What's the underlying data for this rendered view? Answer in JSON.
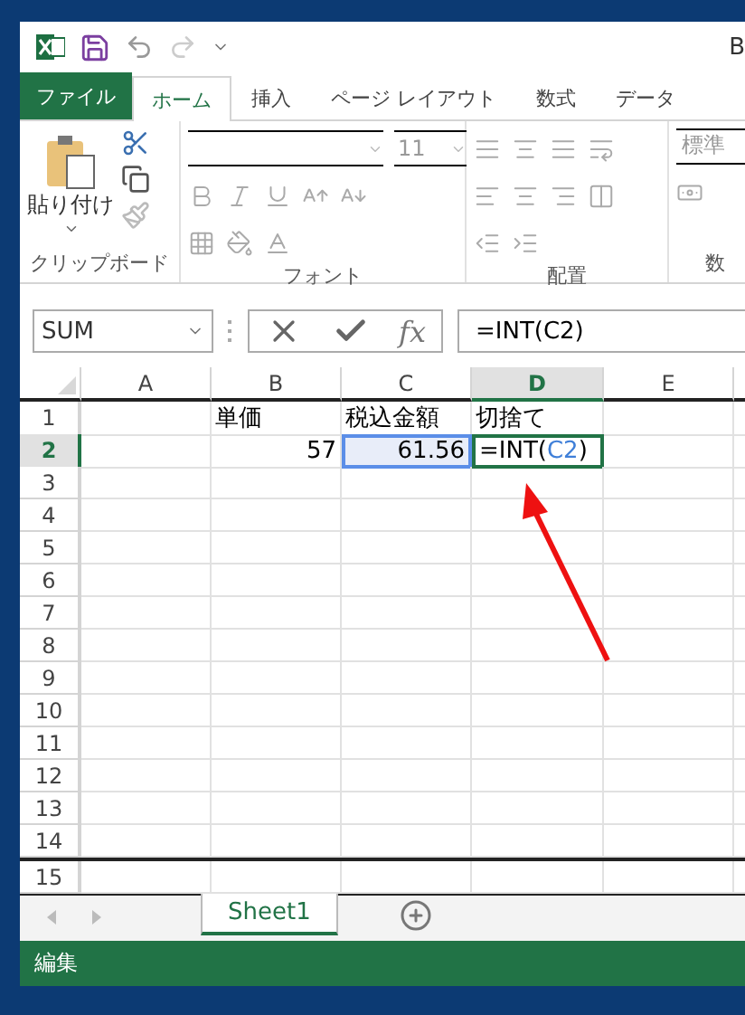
{
  "window": {
    "title": "B"
  },
  "ribbon_tabs": [
    {
      "label": "ファイル",
      "kind": "file",
      "selected": false
    },
    {
      "label": "ホーム",
      "kind": "tab",
      "selected": true
    },
    {
      "label": "挿入",
      "kind": "tab",
      "selected": false
    },
    {
      "label": "ページ レイアウト",
      "kind": "tab",
      "selected": false
    },
    {
      "label": "数式",
      "kind": "tab",
      "selected": false
    },
    {
      "label": "データ",
      "kind": "tab",
      "selected": false
    }
  ],
  "ribbon": {
    "paste_label": "貼り付け",
    "font_size": "11",
    "number_format": "標準",
    "groups": [
      "クリップボード",
      "フォント",
      "配置",
      "数"
    ]
  },
  "formula_bar": {
    "name_box": "SUM",
    "function_button": "fx",
    "formula": "=INT(C2)"
  },
  "columns": [
    {
      "label": "A",
      "selected": false
    },
    {
      "label": "B",
      "selected": false
    },
    {
      "label": "C",
      "selected": false
    },
    {
      "label": "D",
      "selected": true
    },
    {
      "label": "E",
      "selected": false
    }
  ],
  "rows": [
    {
      "label": "1",
      "selected": false,
      "page_break": false,
      "cells": [
        {},
        {
          "kind": "text",
          "text": "単価"
        },
        {
          "kind": "text",
          "text": "税込金額"
        },
        {
          "kind": "text",
          "text": "切捨て"
        },
        {}
      ]
    },
    {
      "label": "2",
      "selected": true,
      "page_break": false,
      "cells": [
        {},
        {
          "kind": "number",
          "text": "57"
        },
        {
          "kind": "number",
          "text": "61.56",
          "referenced": true
        },
        {
          "kind": "formula",
          "active": true,
          "parts": [
            {
              "text": "=INT(",
              "reference": false
            },
            {
              "text": "C2",
              "reference": true
            },
            {
              "text": ")",
              "reference": false
            }
          ]
        },
        {}
      ]
    },
    {
      "label": "3",
      "selected": false,
      "page_break": false
    },
    {
      "label": "4",
      "selected": false,
      "page_break": false
    },
    {
      "label": "5",
      "selected": false,
      "page_break": false
    },
    {
      "label": "6",
      "selected": false,
      "page_break": false
    },
    {
      "label": "7",
      "selected": false,
      "page_break": false
    },
    {
      "label": "8",
      "selected": false,
      "page_break": false
    },
    {
      "label": "9",
      "selected": false,
      "page_break": false
    },
    {
      "label": "10",
      "selected": false,
      "page_break": false
    },
    {
      "label": "11",
      "selected": false,
      "page_break": false
    },
    {
      "label": "12",
      "selected": false,
      "page_break": false
    },
    {
      "label": "13",
      "selected": false,
      "page_break": false
    },
    {
      "label": "14",
      "selected": false,
      "page_break": true
    },
    {
      "label": "15",
      "selected": false,
      "page_break": false
    }
  ],
  "sheet_tabs": [
    {
      "label": "Sheet1",
      "selected": true
    }
  ],
  "status_bar": {
    "mode": "編集"
  }
}
